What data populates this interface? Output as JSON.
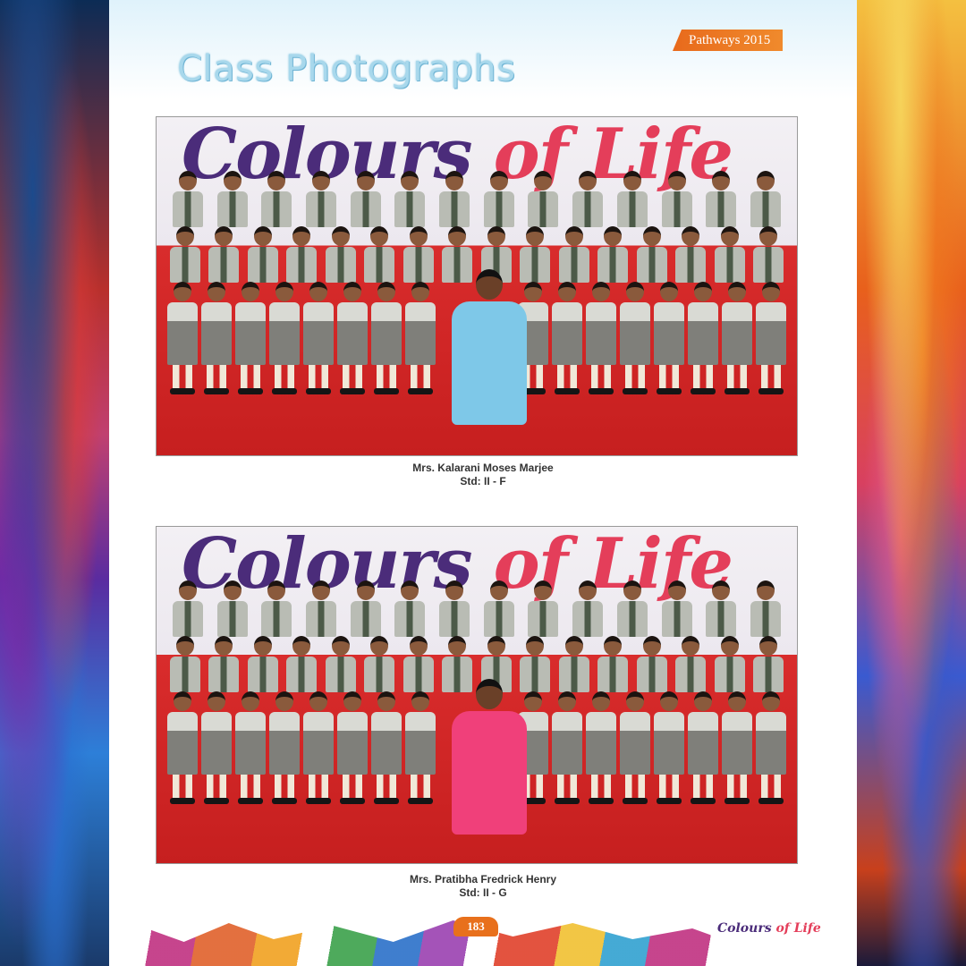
{
  "header": {
    "ribbon_text": "Pathways 2015",
    "page_title": "Class Photographs"
  },
  "photos": [
    {
      "banner_part1": "Colours",
      "banner_part2": "of Life",
      "teacher_name": "Mrs. Kalarani Moses Marjee",
      "standard": "Std: II - F",
      "teacher_saree_color": "#7ec8e8"
    },
    {
      "banner_part1": "Colours",
      "banner_part2": "of Life",
      "teacher_name": "Mrs. Pratibha Fredrick Henry",
      "standard": "Std: II - G",
      "teacher_saree_color": "#f0407a"
    }
  ],
  "footer": {
    "page_number": "183",
    "logo_part1": "Colours",
    "logo_part2": "of Life"
  },
  "colors": {
    "accent_orange": "#e8701c",
    "title_blue": "#a8d8ec",
    "stage_red": "#d92c2c"
  }
}
